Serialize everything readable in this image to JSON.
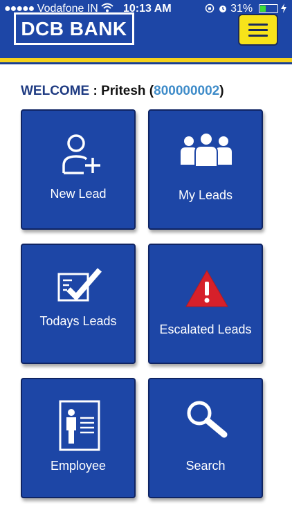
{
  "status_bar": {
    "signal_dots": "●●●●●",
    "carrier": "Vodafone IN",
    "time": "10:13 AM",
    "battery": "31%",
    "battery_level": 0.31
  },
  "header": {
    "logo_text": "DCB BANK",
    "menu_icon": "hamburger-menu-icon"
  },
  "welcome": {
    "prefix": "WELCOME",
    "separator": " : ",
    "name": "Pritesh",
    "open_paren": " (",
    "id": "800000002",
    "close_paren": ")"
  },
  "tiles": [
    {
      "label": "New Lead",
      "icon": "add-user-icon"
    },
    {
      "label": "My Leads",
      "icon": "group-icon"
    },
    {
      "label": "Todays Leads",
      "icon": "checklist-icon"
    },
    {
      "label": "Escalated Leads",
      "icon": "warning-icon"
    },
    {
      "label": "Employee",
      "icon": "employee-card-icon"
    },
    {
      "label": "Search",
      "icon": "search-icon"
    }
  ],
  "colors": {
    "brand_blue": "#1d46a6",
    "accent_yellow": "#f7e31a",
    "warning_red": "#d6202a",
    "id_blue": "#3f8cc9"
  }
}
